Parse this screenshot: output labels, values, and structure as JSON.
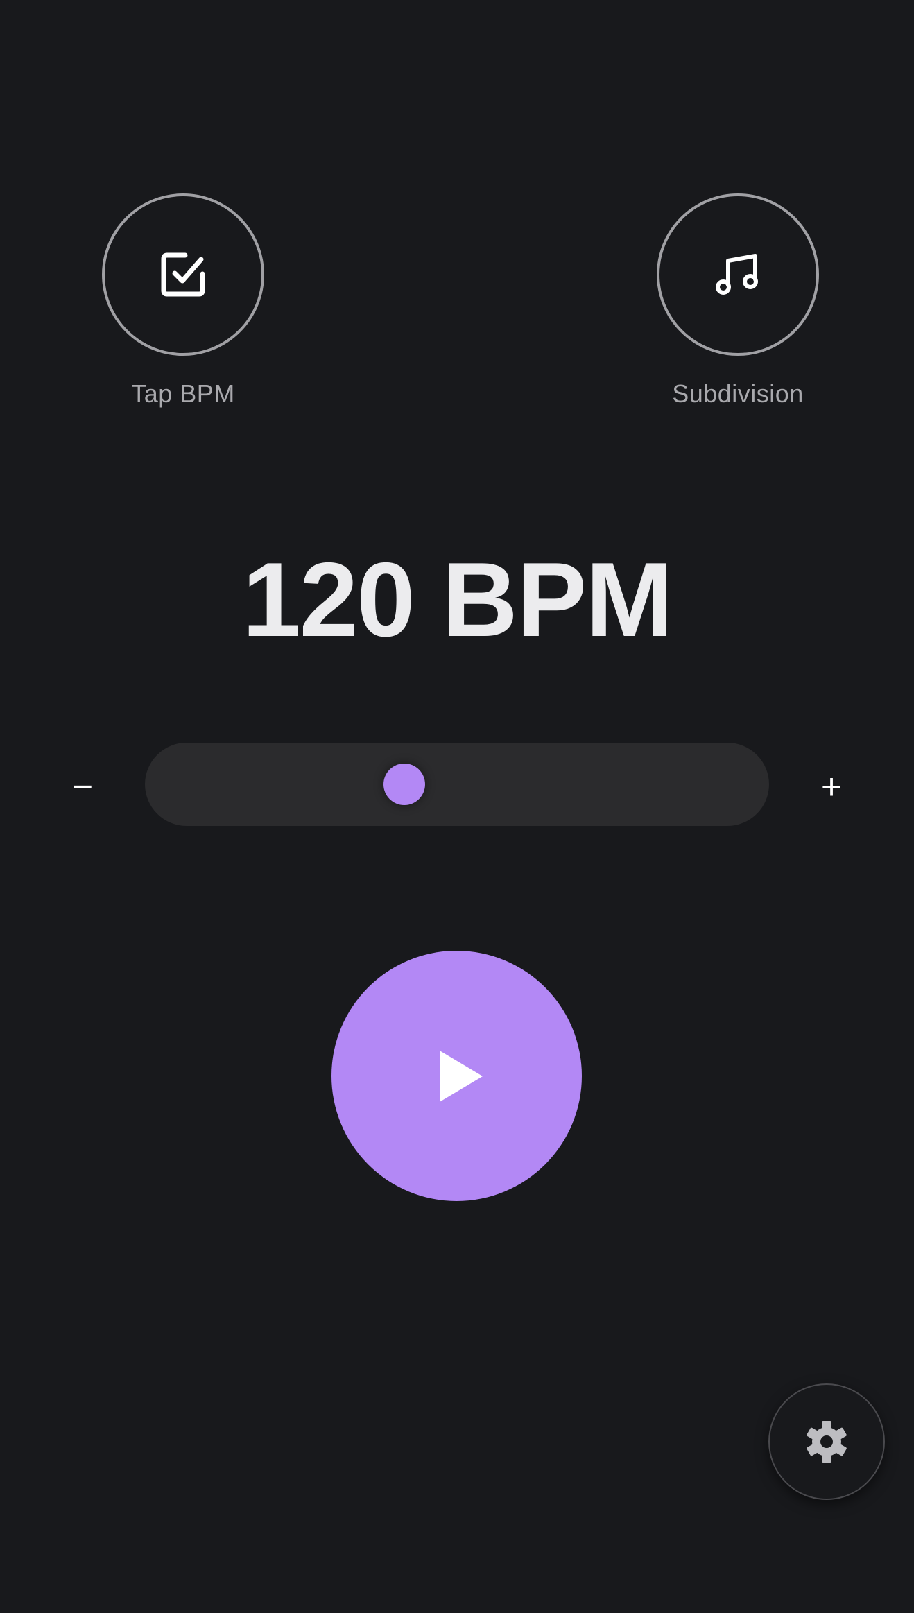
{
  "actions": {
    "tap_bpm": {
      "label": "Tap BPM",
      "icon": "checkbox-icon"
    },
    "subdivision": {
      "label": "Subdivision",
      "icon": "music-note-icon"
    }
  },
  "tempo": {
    "display": "120 BPM",
    "value": 120,
    "slider_fraction": 0.41
  },
  "controls": {
    "decrement_label": "−",
    "increment_label": "+",
    "play_icon": "play-icon",
    "settings_icon": "gear-icon"
  },
  "colors": {
    "background": "#18191c",
    "accent": "#b388f5",
    "track": "#2b2b2d",
    "ring": "#a0a0a4",
    "label": "#a9a9ad"
  }
}
